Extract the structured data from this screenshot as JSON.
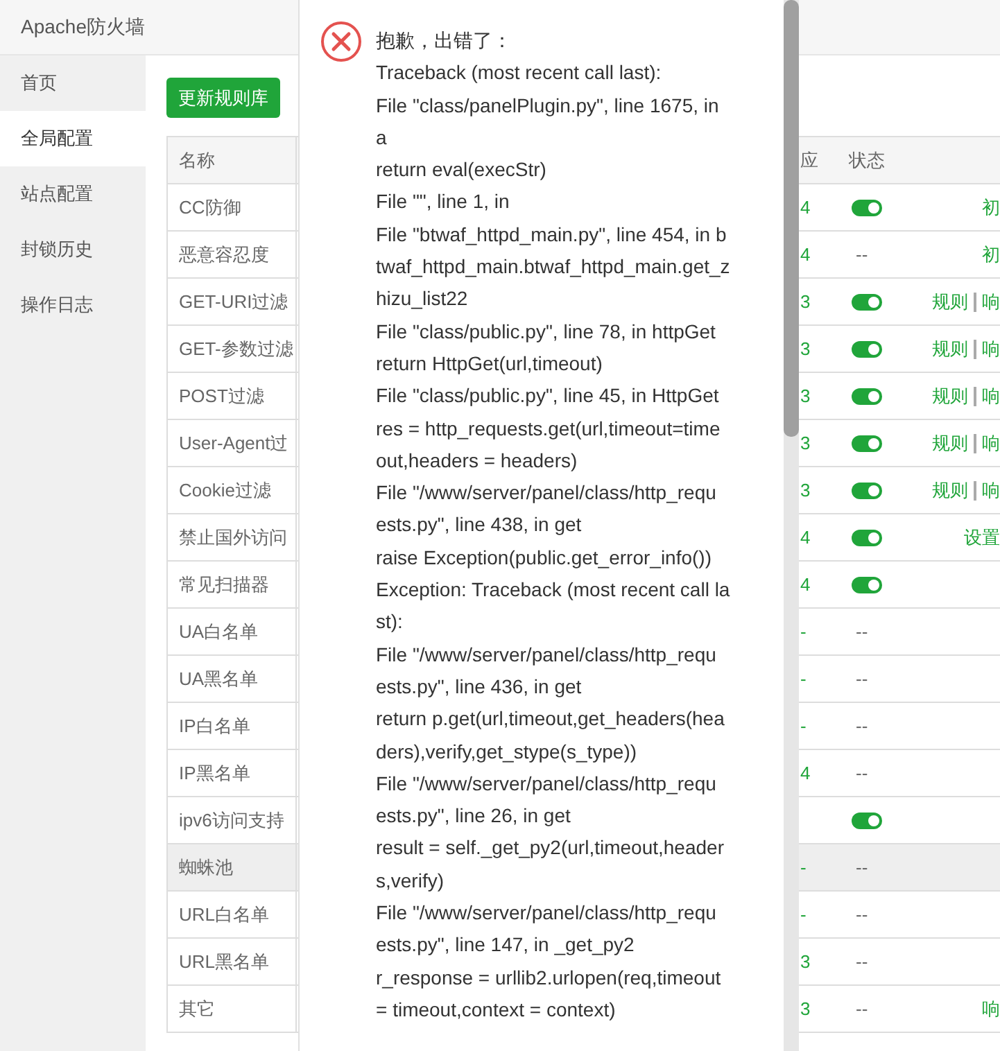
{
  "app": {
    "title": "Apache防火墙"
  },
  "sidebar": {
    "items": [
      {
        "label": "首页",
        "selected": false
      },
      {
        "label": "全局配置",
        "selected": true
      },
      {
        "label": "站点配置",
        "selected": false
      },
      {
        "label": "封锁历史",
        "selected": false
      },
      {
        "label": "操作日志",
        "selected": false
      }
    ]
  },
  "update_button": "更新规则库",
  "table": {
    "columns": {
      "name": "名称",
      "column_2": "应",
      "status": "状态"
    },
    "rows": [
      {
        "name": "CC防御",
        "highlighted": false,
        "column_2": "4",
        "status": {
          "kind": "switch",
          "on": true
        },
        "actions": [
          "初"
        ]
      },
      {
        "name": "恶意容忍度",
        "highlighted": false,
        "column_2": "4",
        "status": {
          "kind": "text",
          "text": "--"
        },
        "actions": [
          "初"
        ]
      },
      {
        "name": "GET-URI过滤",
        "highlighted": false,
        "column_2": "3",
        "status": {
          "kind": "switch",
          "on": true
        },
        "actions": [
          "规则",
          "响"
        ]
      },
      {
        "name": "GET-参数过滤",
        "highlighted": false,
        "column_2": "3",
        "status": {
          "kind": "switch",
          "on": true
        },
        "actions": [
          "规则",
          "响"
        ]
      },
      {
        "name": "POST过滤",
        "highlighted": false,
        "column_2": "3",
        "status": {
          "kind": "switch",
          "on": true
        },
        "actions": [
          "规则",
          "响"
        ]
      },
      {
        "name": "User-Agent过",
        "highlighted": false,
        "column_2": "3",
        "status": {
          "kind": "switch",
          "on": true
        },
        "actions": [
          "规则",
          "响"
        ]
      },
      {
        "name": "Cookie过滤",
        "highlighted": false,
        "column_2": "3",
        "status": {
          "kind": "switch",
          "on": true
        },
        "actions": [
          "规则",
          "响"
        ]
      },
      {
        "name": "禁止国外访问",
        "highlighted": false,
        "column_2": "4",
        "status": {
          "kind": "switch",
          "on": true
        },
        "actions": [
          "设置"
        ]
      },
      {
        "name": "常见扫描器",
        "highlighted": false,
        "column_2": "4",
        "status": {
          "kind": "switch",
          "on": true
        }
      },
      {
        "name": "UA白名单",
        "highlighted": false,
        "column_2": "-",
        "status": {
          "kind": "text",
          "text": "--"
        }
      },
      {
        "name": "UA黑名单",
        "highlighted": false,
        "column_2": "-",
        "status": {
          "kind": "text",
          "text": "--"
        }
      },
      {
        "name": "IP白名单",
        "highlighted": false,
        "column_2": "-",
        "status": {
          "kind": "text",
          "text": "--"
        }
      },
      {
        "name": "IP黑名单",
        "highlighted": false,
        "column_2": "4",
        "status": {
          "kind": "text",
          "text": "--"
        }
      },
      {
        "name": "ipv6访问支持",
        "highlighted": false,
        "status": {
          "kind": "switch",
          "on": true
        }
      },
      {
        "name": "蜘蛛池",
        "highlighted": true,
        "column_2": "-",
        "status": {
          "kind": "text",
          "text": "--"
        }
      },
      {
        "name": "URL白名单",
        "highlighted": false,
        "column_2": "-",
        "status": {
          "kind": "text",
          "text": "--"
        }
      },
      {
        "name": "URL黑名单",
        "highlighted": false,
        "column_2": "3",
        "status": {
          "kind": "text",
          "text": "--"
        }
      },
      {
        "name": "其它",
        "highlighted": false,
        "column_2": "3",
        "status": {
          "kind": "text",
          "text": "--"
        },
        "actions": [
          "响"
        ]
      }
    ]
  },
  "error_dialog": {
    "heading": "抱歉，出错了：",
    "lines": [
      "Traceback (most recent call last):",
      "File \"class/panelPlugin.py\", line 1675, in",
      "a",
      "return eval(execStr)",
      "File \"\", line 1, in",
      "File \"btwaf_httpd_main.py\", line 454, in b",
      "twaf_httpd_main.btwaf_httpd_main.get_z",
      "hizu_list22",
      "File \"class/public.py\", line 78, in httpGet",
      "return HttpGet(url,timeout)",
      "File \"class/public.py\", line 45, in HttpGet",
      "res = http_requests.get(url,timeout=time",
      "out,headers = headers)",
      "File \"/www/server/panel/class/http_requ",
      "ests.py\", line 438, in get",
      "raise Exception(public.get_error_info())",
      "Exception: Traceback (most recent call la",
      "st):",
      "File \"/www/server/panel/class/http_requ",
      "ests.py\", line 436, in get",
      "return p.get(url,timeout,get_headers(hea",
      "ders),verify,get_stype(s_type))",
      "File \"/www/server/panel/class/http_requ",
      "ests.py\", line 26, in get",
      "result = self._get_py2(url,timeout,header",
      "s,verify)",
      "File \"/www/server/panel/class/http_requ",
      "ests.py\", line 147, in _get_py2",
      "r_response = urllib2.urlopen(req,timeout",
      "= timeout,context = context)"
    ]
  }
}
